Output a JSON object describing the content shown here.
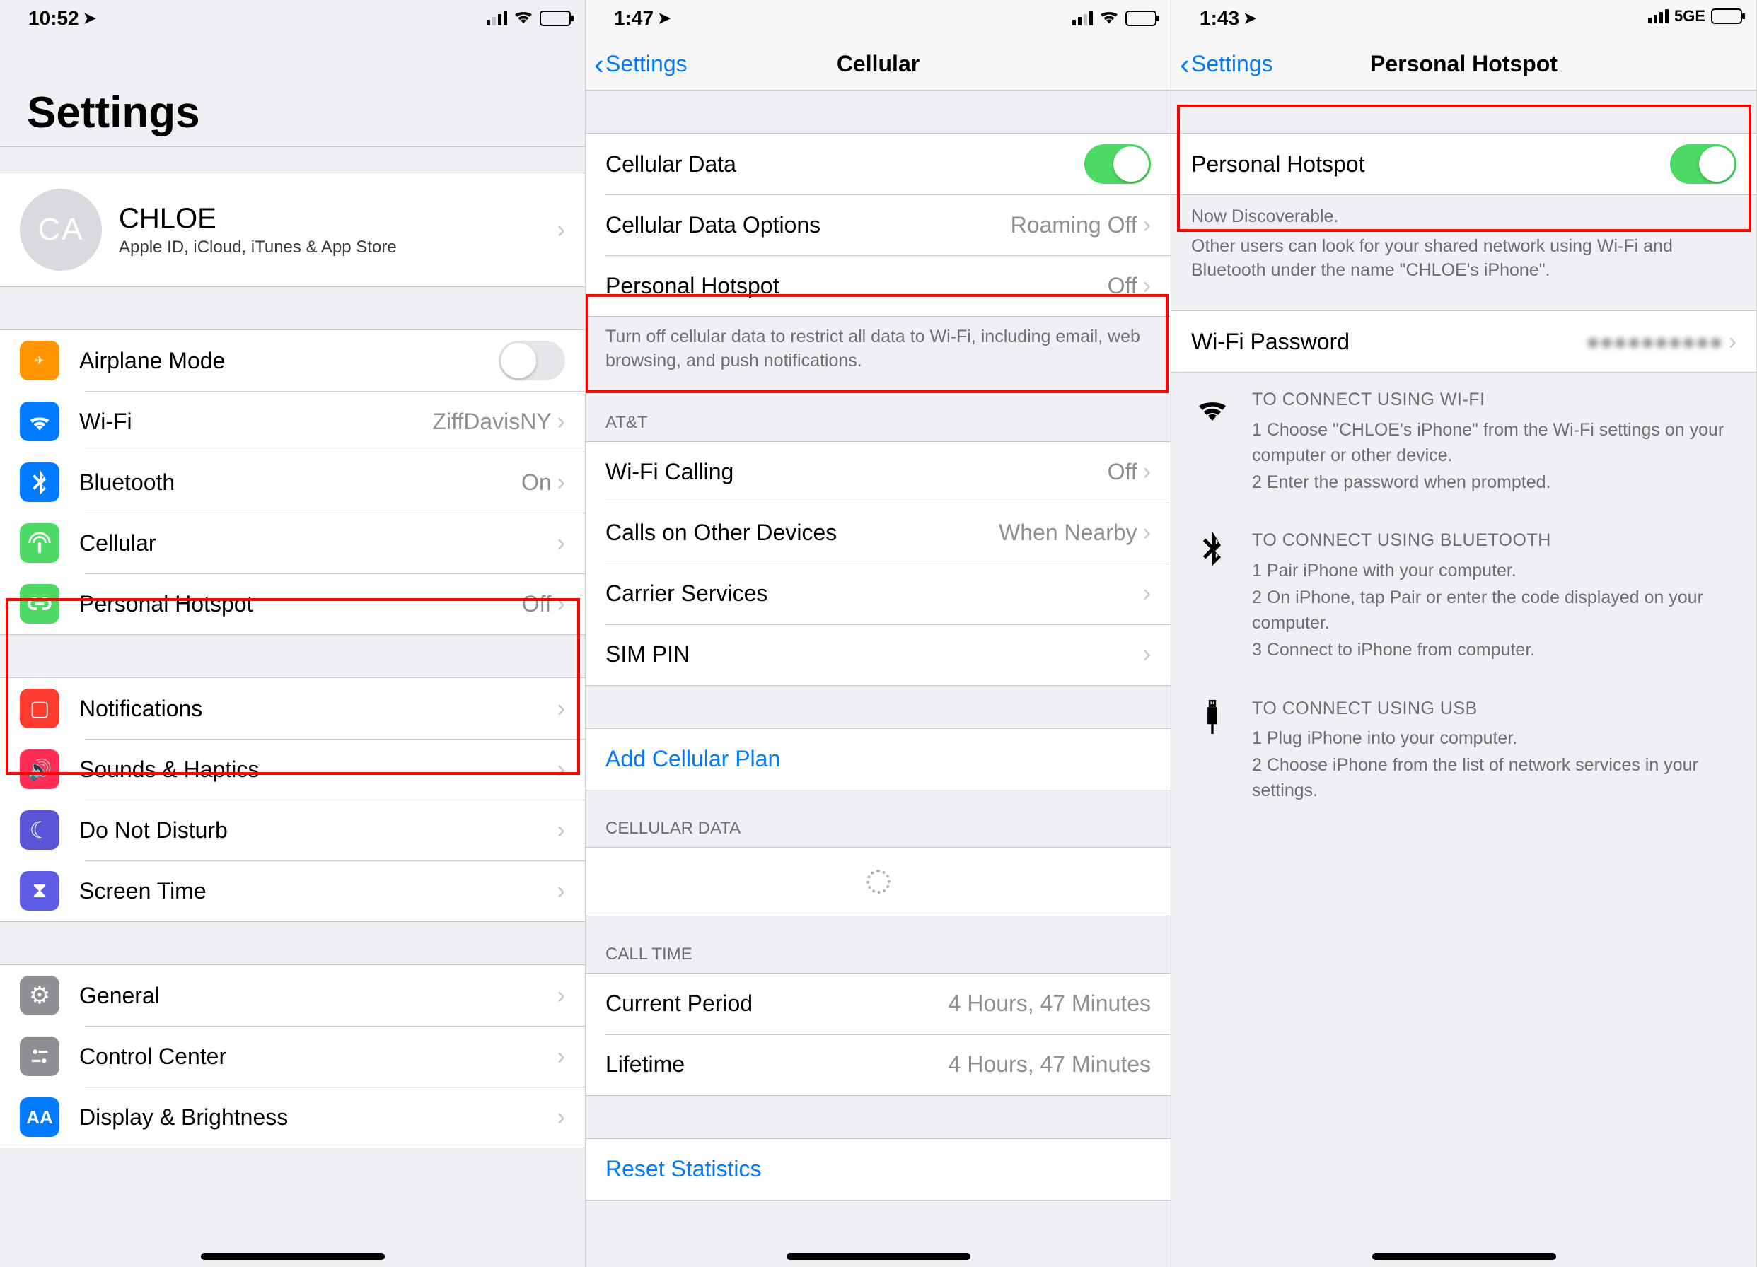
{
  "screens": {
    "settings": {
      "status": {
        "time": "10:52",
        "network": "wifi"
      },
      "title": "Settings",
      "profile": {
        "initials": "CA",
        "name": "CHLOE",
        "sub": "Apple ID, iCloud, iTunes & App Store"
      },
      "g1": [
        {
          "icon": "airplane",
          "label": "Airplane Mode",
          "type": "toggle",
          "on": false
        },
        {
          "icon": "wifi",
          "label": "Wi-Fi",
          "detail": "ZiffDavisNY"
        },
        {
          "icon": "bluetooth",
          "label": "Bluetooth",
          "detail": "On"
        },
        {
          "icon": "cellular",
          "label": "Cellular",
          "detail": ""
        },
        {
          "icon": "hotspot",
          "label": "Personal Hotspot",
          "detail": "Off"
        }
      ],
      "g2": [
        {
          "icon": "notifications",
          "label": "Notifications"
        },
        {
          "icon": "sounds",
          "label": "Sounds & Haptics"
        },
        {
          "icon": "dnd",
          "label": "Do Not Disturb"
        },
        {
          "icon": "screentime",
          "label": "Screen Time"
        }
      ],
      "g3": [
        {
          "icon": "general",
          "label": "General"
        },
        {
          "icon": "controlcenter",
          "label": "Control Center"
        },
        {
          "icon": "display",
          "label": "Display & Brightness"
        }
      ]
    },
    "cellular": {
      "status": {
        "time": "1:47",
        "network": "wifi"
      },
      "back": "Settings",
      "title": "Cellular",
      "g1": [
        {
          "label": "Cellular Data",
          "type": "toggle",
          "on": true
        },
        {
          "label": "Cellular Data Options",
          "detail": "Roaming Off"
        },
        {
          "label": "Personal Hotspot",
          "detail": "Off"
        }
      ],
      "g1_footer": "Turn off cellular data to restrict all data to Wi-Fi, including email, web browsing, and push notifications.",
      "g2_header": "AT&T",
      "g2": [
        {
          "label": "Wi-Fi Calling",
          "detail": "Off"
        },
        {
          "label": "Calls on Other Devices",
          "detail": "When Nearby"
        },
        {
          "label": "Carrier Services",
          "detail": ""
        },
        {
          "label": "SIM PIN",
          "detail": ""
        }
      ],
      "g3_link": "Add Cellular Plan",
      "g4_header": "CELLULAR DATA",
      "g5_header": "CALL TIME",
      "g5": [
        {
          "label": "Current Period",
          "detail": "4 Hours, 47 Minutes"
        },
        {
          "label": "Lifetime",
          "detail": "4 Hours, 47 Minutes"
        }
      ],
      "g6_link": "Reset Statistics"
    },
    "hotspot": {
      "status": {
        "time": "1:43",
        "network": "5GE"
      },
      "back": "Settings",
      "title": "Personal Hotspot",
      "toggle_label": "Personal Hotspot",
      "toggle_on": true,
      "discover": "Now Discoverable.",
      "discover_sub": "Other users can look for your shared network using Wi-Fi and Bluetooth under the name \"CHLOE's iPhone\".",
      "wifi_pw_label": "Wi-Fi Password",
      "inst": [
        {
          "glyph": "wifi",
          "hd": "TO CONNECT USING WI-FI",
          "lines": [
            "1 Choose \"CHLOE's iPhone\" from the Wi-Fi settings on your computer or other device.",
            "2 Enter the password when prompted."
          ]
        },
        {
          "glyph": "bluetooth",
          "hd": "TO CONNECT USING BLUETOOTH",
          "lines": [
            "1 Pair iPhone with your computer.",
            "2 On iPhone, tap Pair or enter the code displayed on your computer.",
            "3 Connect to iPhone from computer."
          ]
        },
        {
          "glyph": "usb",
          "hd": "TO CONNECT USING USB",
          "lines": [
            "1 Plug iPhone into your computer.",
            "2 Choose iPhone from the list of network services in your settings."
          ]
        }
      ]
    }
  }
}
